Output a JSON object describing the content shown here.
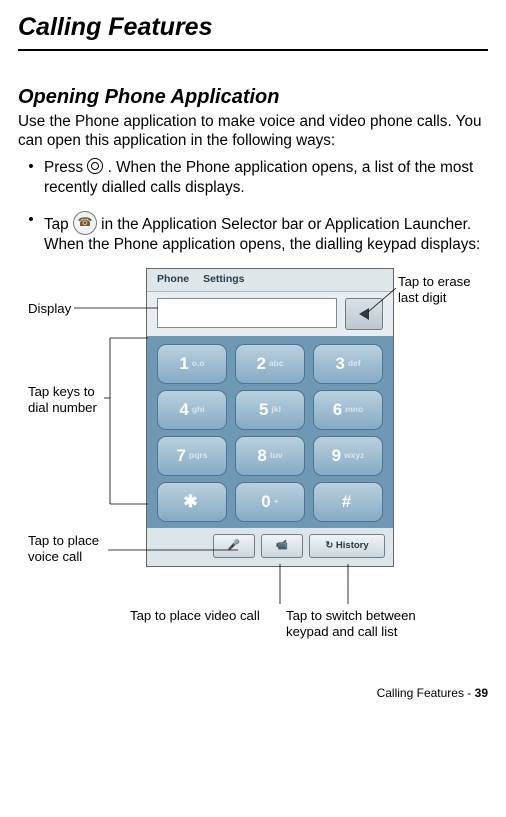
{
  "page": {
    "title": "Calling Features",
    "section_title": "Opening Phone Application",
    "intro": "Use the Phone application to make voice and video phone calls. You can open this application in the following ways:",
    "bullets": [
      {
        "pre": "Press ",
        "post": ". When the Phone application opens, a list of the most recently dialled calls displays."
      },
      {
        "pre": "Tap ",
        "post": " in the Application Selector bar or Application Launcher. When the Phone application opens, the dialling keypad displays:"
      }
    ],
    "footer_text": "Calling Features - ",
    "footer_page": "39"
  },
  "labels": {
    "erase": "Tap to erase last digit",
    "display": "Display",
    "dial": "Tap keys to dial number",
    "place_voice": "Tap to place voice call",
    "place_video": "Tap to place video call",
    "history": "Tap to switch between keypad and call list"
  },
  "shot": {
    "tabs": {
      "phone": "Phone",
      "settings": "Settings"
    },
    "keys": [
      {
        "n": "1",
        "s": "o.o"
      },
      {
        "n": "2",
        "s": "abc"
      },
      {
        "n": "3",
        "s": "def"
      },
      {
        "n": "4",
        "s": "ghi"
      },
      {
        "n": "5",
        "s": "jkl"
      },
      {
        "n": "6",
        "s": "mno"
      },
      {
        "n": "7",
        "s": "pqrs"
      },
      {
        "n": "8",
        "s": "tuv"
      },
      {
        "n": "9",
        "s": "wxyz"
      },
      {
        "n": "✱",
        "s": ""
      },
      {
        "n": "0",
        "s": "+"
      },
      {
        "n": "#",
        "s": ""
      }
    ],
    "bottom": {
      "voice_icon": "🎤",
      "video_icon": "📹",
      "history_label": "↻ History"
    }
  }
}
